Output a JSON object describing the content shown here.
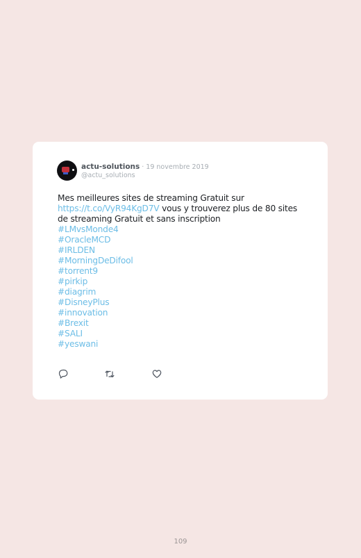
{
  "tweet": {
    "display_name": "actu-solutions",
    "separator": "·",
    "date": "19 novembre 2019",
    "handle": "@actu_solutions",
    "text_before_link": "Mes meilleures sites de streaming Gratuit sur ",
    "link": "https://t.co/VyR94KgD7V",
    "text_after_link": " vous y trouverez plus de 80 sites de streaming Gratuit et sans inscription",
    "hashtags": [
      "#LMvsMonde4",
      "#OracleMCD",
      "#IRLDEN",
      "#MorningDeDifool",
      "#torrent9",
      "#pirkip",
      "#diagrim",
      "#DisneyPlus",
      "#innovation",
      "#Brexit",
      "#SALI",
      "#yeswani"
    ],
    "actions": {
      "reply_icon": "reply-icon",
      "retweet_icon": "retweet-icon",
      "like_icon": "heart-icon"
    }
  },
  "page": {
    "number": "109"
  },
  "colors": {
    "background": "#f5e6e4",
    "card": "#ffffff",
    "link": "#6cbde6",
    "muted": "#a7adb3"
  }
}
